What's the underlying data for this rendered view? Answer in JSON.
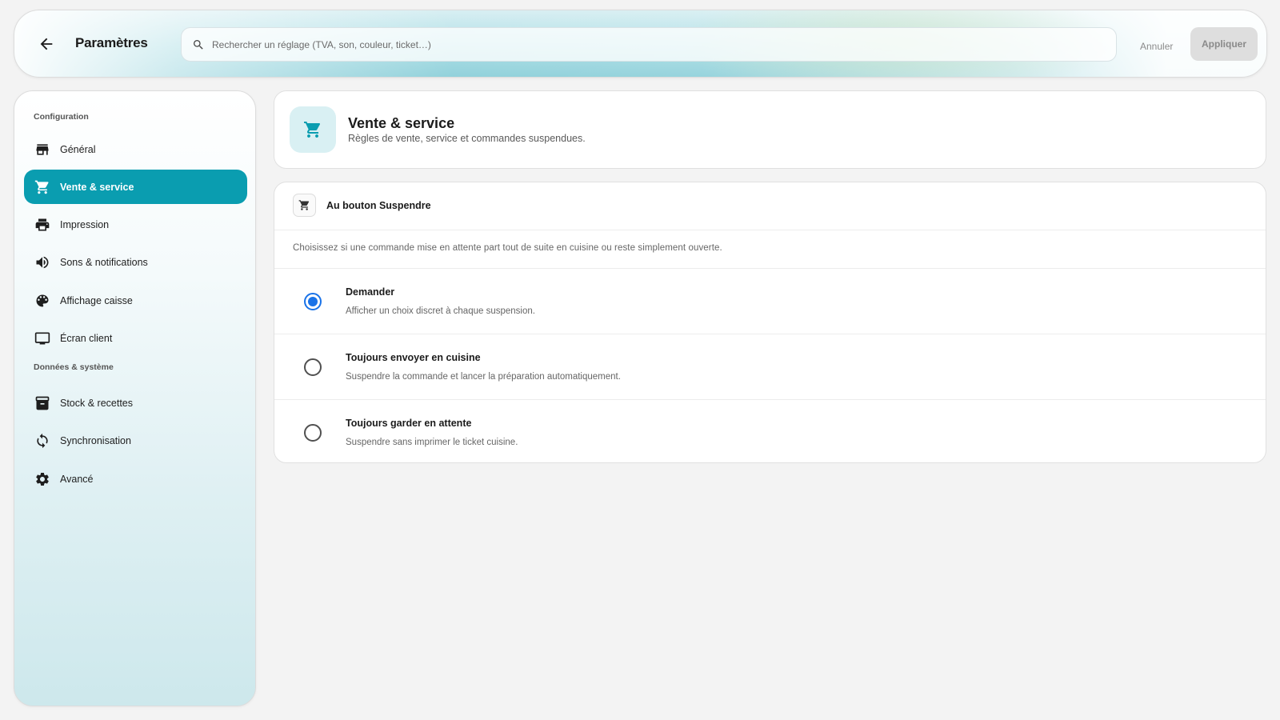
{
  "header": {
    "title": "Paramètres",
    "search_placeholder": "Rechercher un réglage (TVA, son, couleur, ticket…)",
    "search_value": "",
    "cancel_label": "Annuler",
    "apply_label": "Appliquer"
  },
  "sidebar": {
    "section_config": "Configuration",
    "section_data": "Données & système",
    "items": [
      {
        "label": "Général",
        "icon": "store-icon"
      },
      {
        "label": "Vente & service",
        "icon": "cart-icon",
        "active": true
      },
      {
        "label": "Impression",
        "icon": "printer-icon"
      },
      {
        "label": "Sons & notifications",
        "icon": "volume-icon"
      },
      {
        "label": "Affichage caisse",
        "icon": "palette-icon"
      },
      {
        "label": "Écran client",
        "icon": "monitor-icon"
      },
      {
        "label": "Stock & recettes",
        "icon": "archive-icon"
      },
      {
        "label": "Synchronisation",
        "icon": "sync-icon"
      },
      {
        "label": "Avancé",
        "icon": "gear-icon"
      }
    ]
  },
  "main": {
    "section_title": "Vente & service",
    "section_subtitle": "Règles de vente, service et commandes suspendues.",
    "card": {
      "title": "Au bouton Suspendre",
      "description": "Choisissez si une commande mise en attente part tout de suite en cuisine ou reste simplement ouverte.",
      "options": [
        {
          "title": "Demander",
          "subtitle": "Afficher un choix discret à chaque suspension.",
          "selected": true
        },
        {
          "title": "Toujours envoyer en cuisine",
          "subtitle": "Suspendre la commande et lancer la préparation automatiquement.",
          "selected": false
        },
        {
          "title": "Toujours garder en attente",
          "subtitle": "Suspendre sans imprimer le ticket cuisine.",
          "selected": false
        }
      ]
    }
  },
  "colors": {
    "accent": "#0a9db0",
    "radio_selected": "#1a73e8",
    "icon_tile": "#d9f0f3"
  }
}
